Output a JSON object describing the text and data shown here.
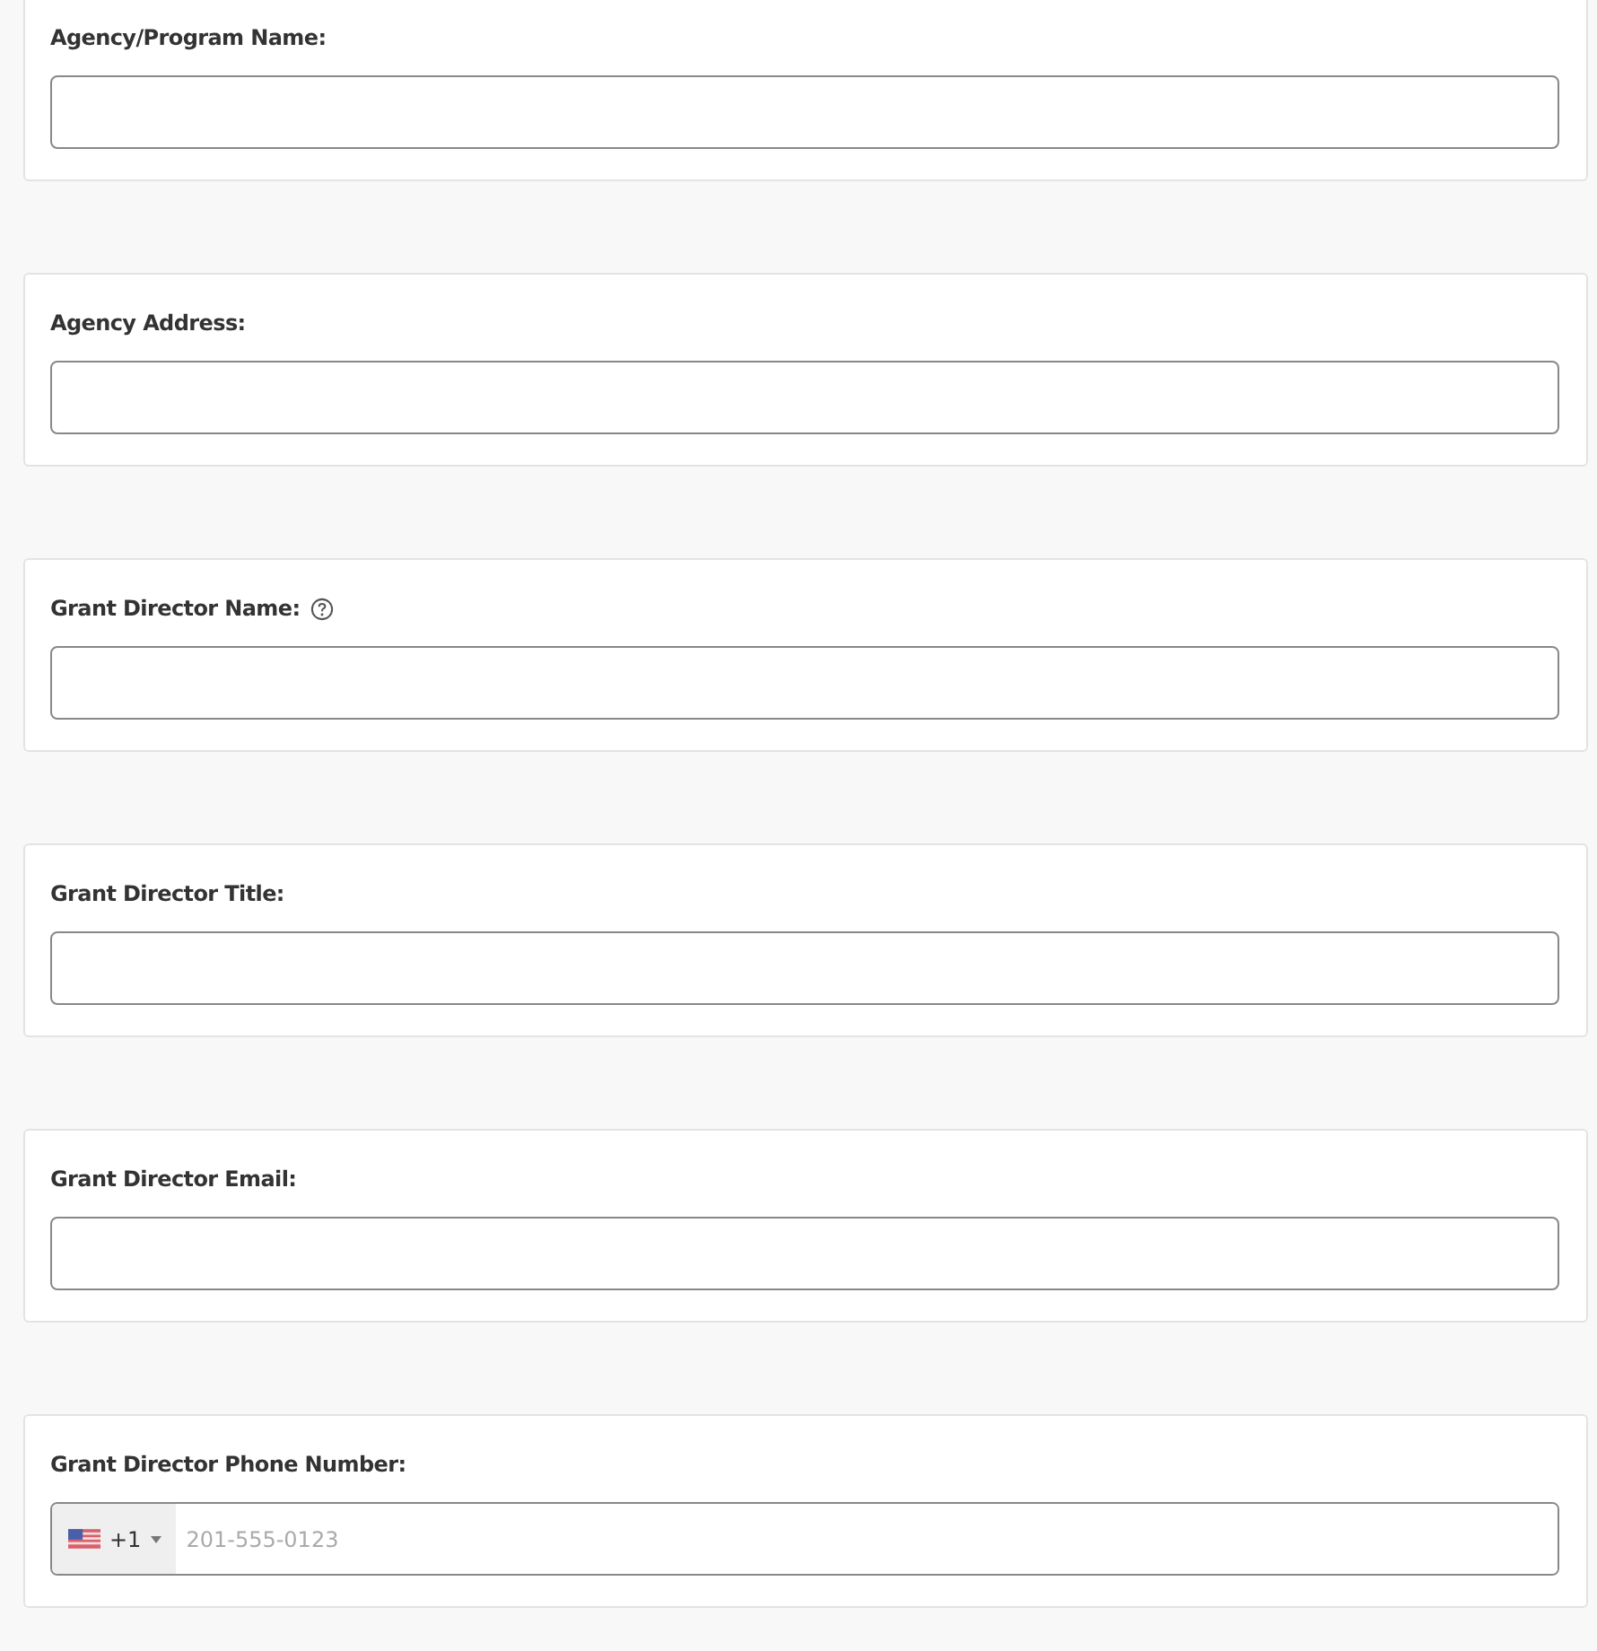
{
  "fields": [
    {
      "label": "Agency/Program Name:",
      "kind": "text",
      "help": false
    },
    {
      "label": "Agency Address:",
      "kind": "text",
      "help": false
    },
    {
      "label": "Grant Director Name:",
      "kind": "text",
      "help": true
    },
    {
      "label": "Grant Director Title:",
      "kind": "text",
      "help": false
    },
    {
      "label": "Grant Director Email:",
      "kind": "text",
      "help": false
    },
    {
      "label": "Grant Director Phone Number:",
      "kind": "phone",
      "help": false,
      "country_code": "+1",
      "placeholder": "201-555-0123"
    }
  ]
}
